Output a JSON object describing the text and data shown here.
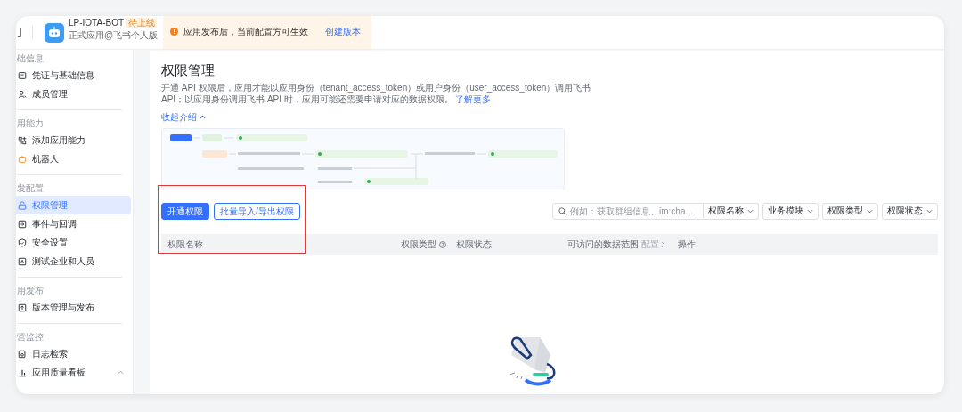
{
  "app": {
    "name": "LP-IOTA-BOT",
    "status": "待上线",
    "edition": "正式应用@飞书个人版"
  },
  "notice": {
    "text": "应用发布后，当前配置方可生效",
    "link": "创建版本"
  },
  "sidebar": {
    "sections": [
      {
        "title": "础信息",
        "items": [
          {
            "label": "凭证与基础信息",
            "kind": "link",
            "selected": false
          },
          {
            "label": "成员管理",
            "kind": "link",
            "selected": false
          }
        ]
      },
      {
        "title": "用能力",
        "items": [
          {
            "label": "添加应用能力",
            "kind": "link",
            "selected": false
          },
          {
            "label": "机器人",
            "kind": "link",
            "selected": false
          }
        ]
      },
      {
        "title": "发配置",
        "items": [
          {
            "label": "权限管理",
            "kind": "link",
            "selected": true
          },
          {
            "label": "事件与回调",
            "kind": "link",
            "selected": false
          },
          {
            "label": "安全设置",
            "kind": "link",
            "selected": false
          },
          {
            "label": "测试企业和人员",
            "kind": "link",
            "selected": false
          }
        ]
      },
      {
        "title": "用发布",
        "items": [
          {
            "label": "版本管理与发布",
            "kind": "link",
            "selected": false
          }
        ]
      },
      {
        "title": "营监控",
        "items": [
          {
            "label": "日志检索",
            "kind": "link",
            "selected": false
          },
          {
            "label": "应用质量看板",
            "kind": "group",
            "selected": false
          }
        ]
      }
    ]
  },
  "page": {
    "title": "权限管理",
    "description": "开通 API 权限后，应用才能以应用身份（tenant_access_token）或用户身份（user_access_token）调用飞书 API；以应用身份调用飞书 API 时，应用可能还需要申请对应的数据权限。",
    "more_link": "了解更多",
    "collapse_link": "收起介绍"
  },
  "actions": [
    {
      "label": "开通权限",
      "kind": "primary"
    },
    {
      "label": "批量导入/导出权限",
      "kind": "outline"
    }
  ],
  "search": {
    "placeholder": "例如：获取群组信息、im:cha..."
  },
  "filters": [
    {
      "label": "权限名称",
      "kind": "attached"
    },
    {
      "label": "业务模块",
      "kind": "select"
    },
    {
      "label": "权限类型",
      "kind": "select"
    },
    {
      "label": "权限状态",
      "kind": "select"
    }
  ],
  "table": {
    "columns": [
      {
        "label": "权限名称"
      },
      {
        "label": "权限类型",
        "info": true
      },
      {
        "label": "权限状态"
      },
      {
        "label": "可访问的数据范围",
        "extra": "配置"
      },
      {
        "label": "操作"
      }
    ]
  }
}
